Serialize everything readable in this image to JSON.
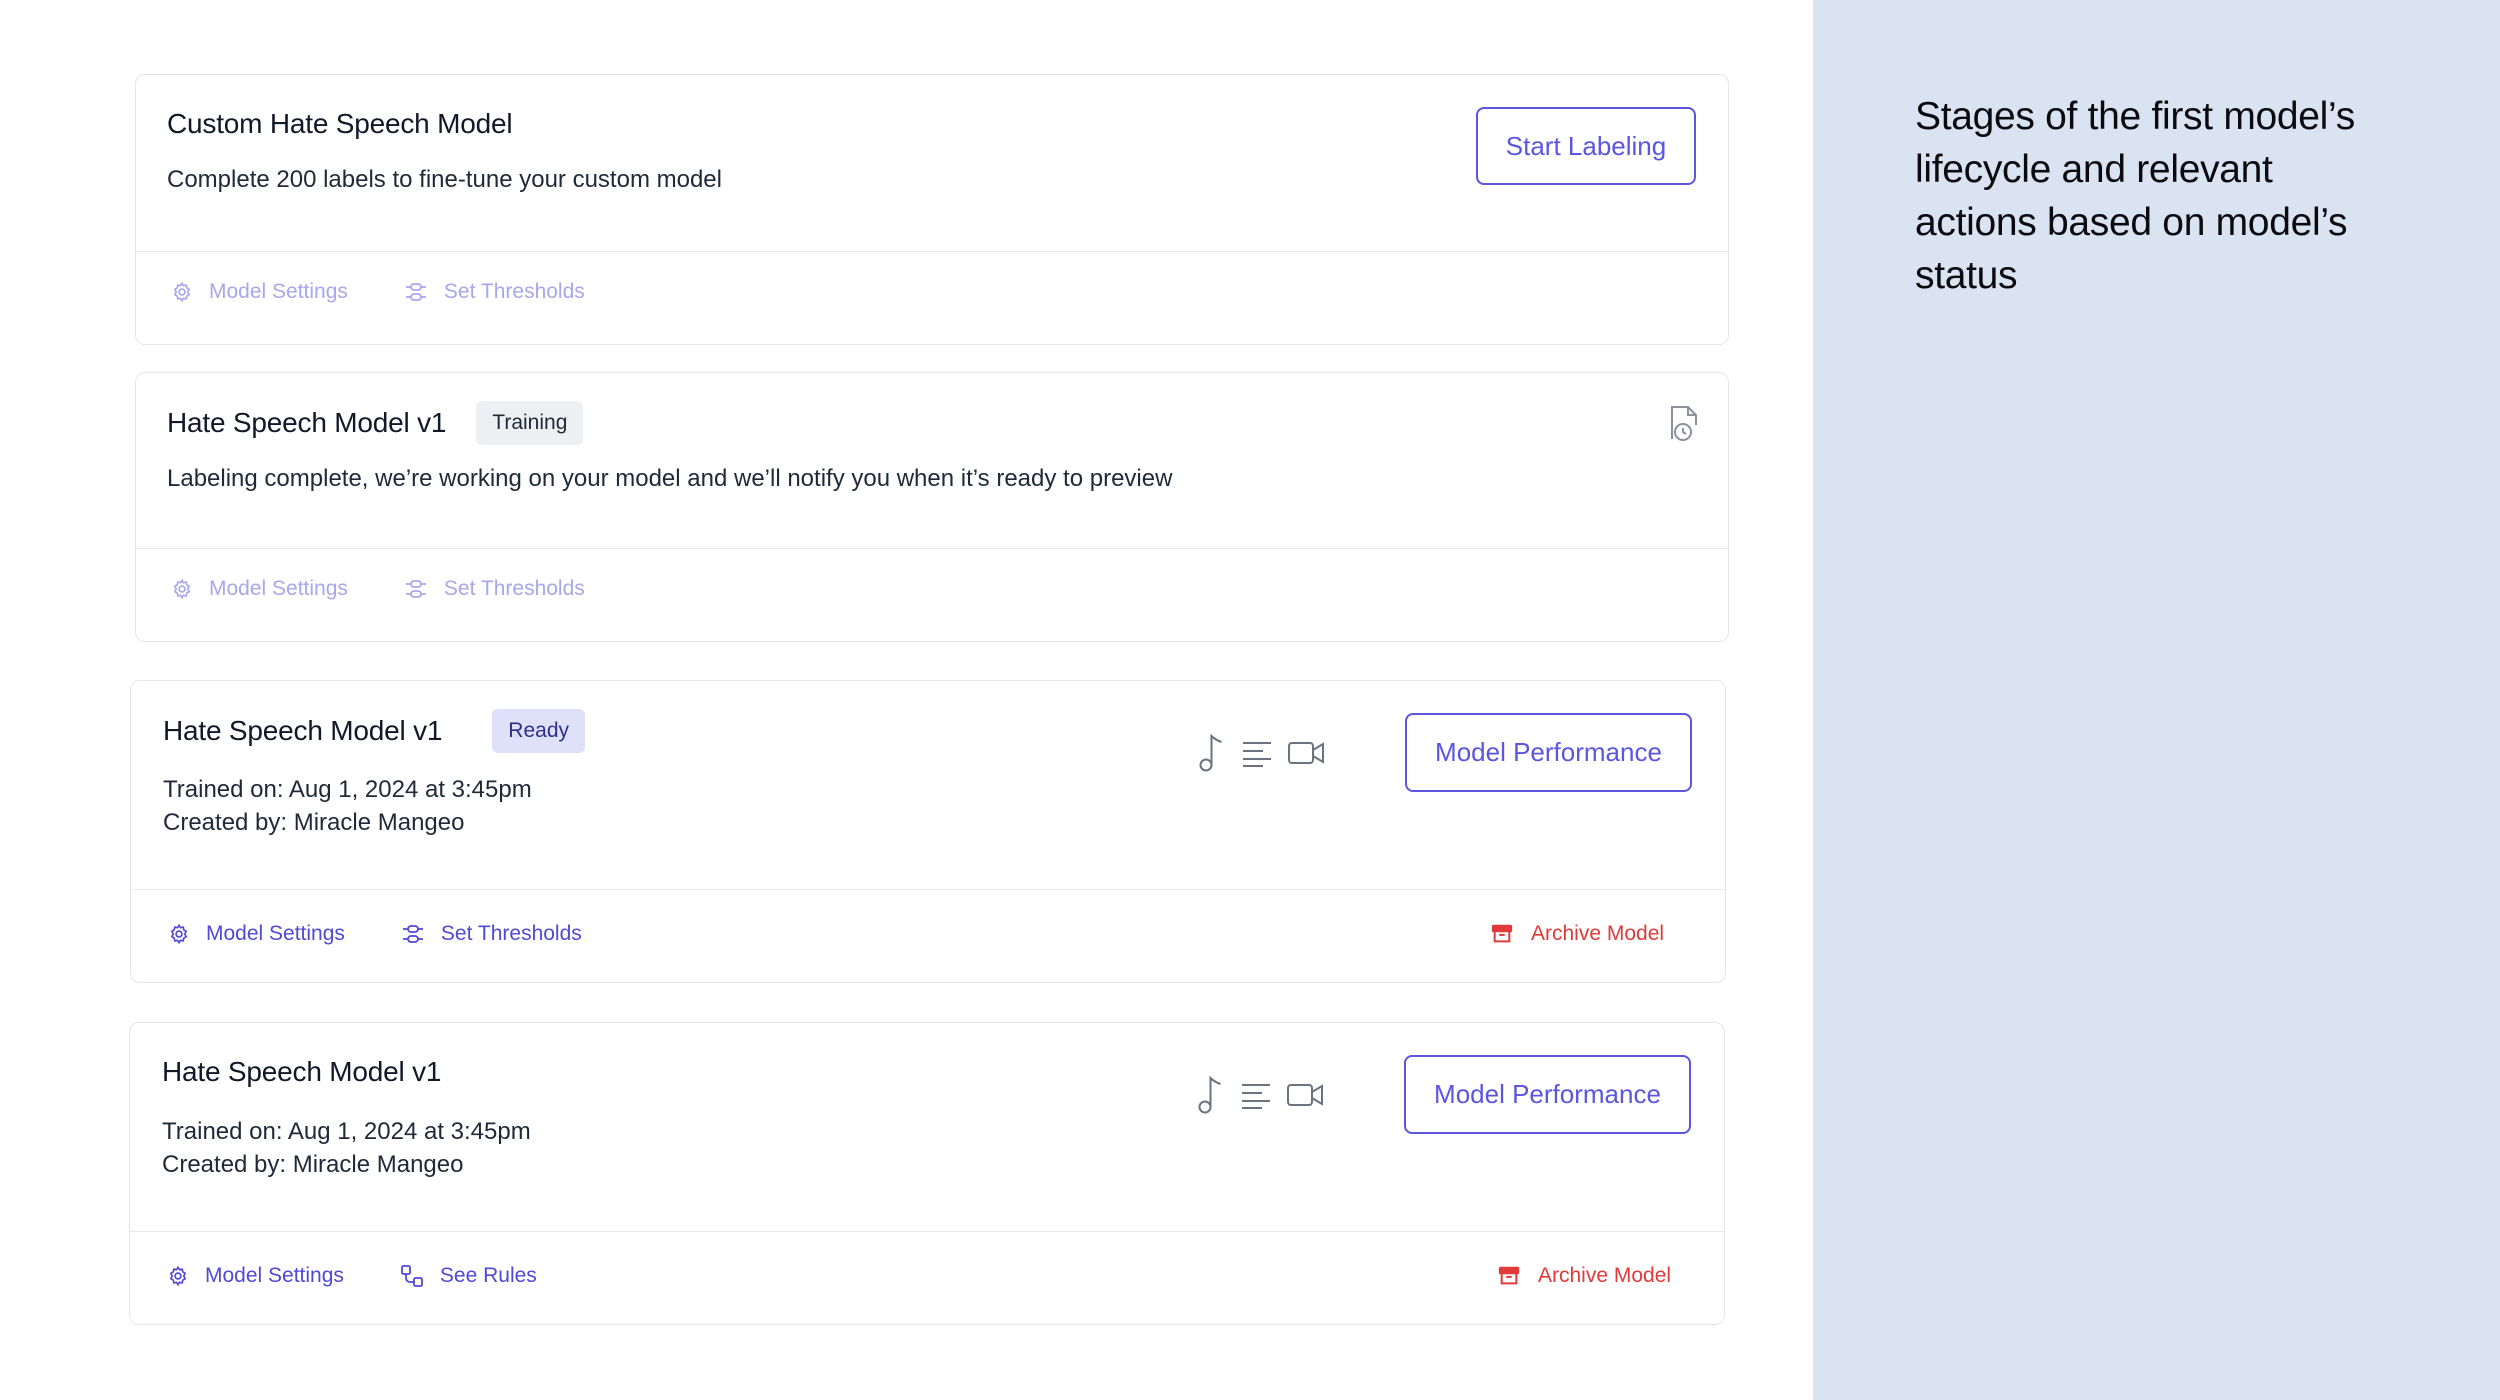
{
  "annotation": {
    "text": "Stages of the first model’s lifecycle and relevant actions based on model’s status"
  },
  "cards": [
    {
      "title": "Custom Hate Speech Model",
      "description": "Complete 200 labels to fine-tune your custom model",
      "button": "Start Labeling",
      "actions": [
        "Model Settings",
        "Set Thresholds"
      ],
      "actions_state": "disabled"
    },
    {
      "title": "Hate Speech Model v1",
      "badge": "Training",
      "description": "Labeling complete, we’re working on your model and we’ll notify you when it’s ready to preview",
      "icon": "document-clock-icon",
      "actions": [
        "Model Settings",
        "Set Thresholds"
      ],
      "actions_state": "disabled"
    },
    {
      "title": "Hate Speech Model v1",
      "badge": "Ready",
      "trained_on": "Trained on: Aug 1, 2024 at 3:45pm",
      "created_by": "Created by: Miracle Mangeo",
      "media_icons": [
        "music-note-icon",
        "text-lines-icon",
        "video-camera-icon"
      ],
      "button": "Model Performance",
      "actions": [
        "Model Settings",
        "Set Thresholds"
      ],
      "actions_state": "active",
      "archive": "Archive Model"
    },
    {
      "title": "Hate Speech Model v1",
      "trained_on": "Trained on: Aug 1, 2024 at 3:45pm",
      "created_by": "Created by: Miracle Mangeo",
      "media_icons": [
        "music-note-icon",
        "text-lines-icon",
        "video-camera-icon"
      ],
      "button": "Model Performance",
      "actions": [
        "Model Settings",
        "See Rules"
      ],
      "actions_state": "active",
      "archive": "Archive Model"
    }
  ],
  "colors": {
    "accent": "#5b55e0",
    "accent_disabled": "#a9a6ec",
    "danger": "#e03a3a",
    "side_panel": "#d9e3f1",
    "ready_badge_bg": "#dfe0f9",
    "training_badge_bg": "#eeeff2"
  }
}
